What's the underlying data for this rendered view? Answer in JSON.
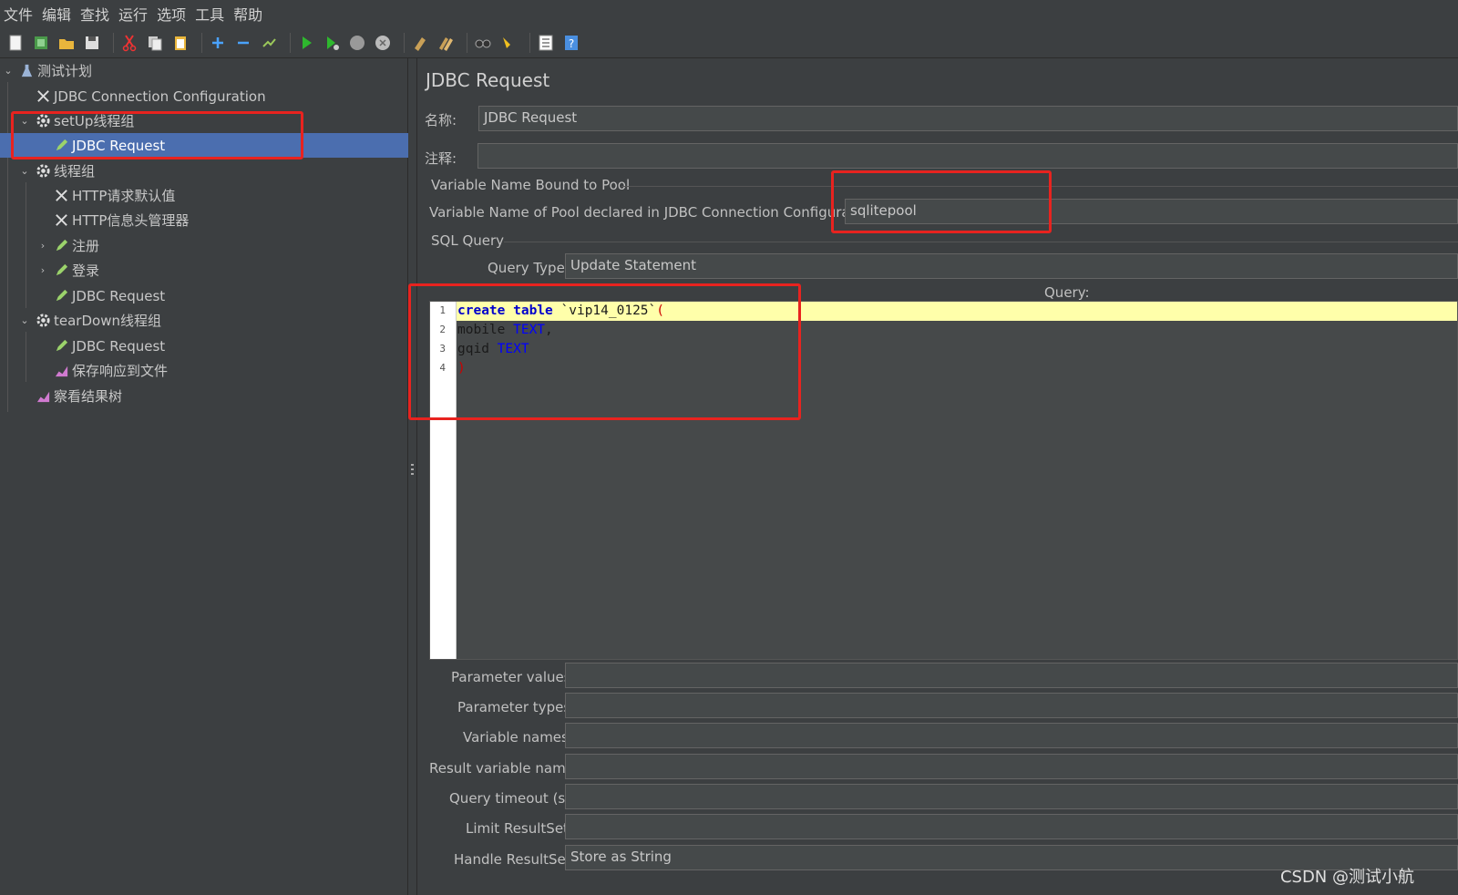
{
  "menu": [
    "文件",
    "编辑",
    "查找",
    "运行",
    "选项",
    "工具",
    "帮助"
  ],
  "toolbar_icons": [
    "new-icon",
    "templates-icon",
    "open-icon",
    "save-icon",
    "cut-icon",
    "copy-icon",
    "paste-icon",
    "expand-icon",
    "collapse-icon",
    "toggle-icon",
    "start-icon",
    "start-no-pause-icon",
    "stop-icon",
    "shutdown-icon",
    "clear-icon",
    "clear-all-icon",
    "search-icon",
    "reset-search-icon",
    "function-helper-icon",
    "help-icon"
  ],
  "tree": {
    "plan": "测试计划",
    "jdbc_config": "JDBC Connection Configuration",
    "setup_group": "setUp线程组",
    "setup_jdbc": "JDBC Request",
    "thread_group": "线程组",
    "http_defaults": "HTTP请求默认值",
    "http_headers": "HTTP信息头管理器",
    "register": "注册",
    "login": "登录",
    "tg_jdbc": "JDBC Request",
    "teardown_group": "tearDown线程组",
    "teardown_jdbc": "JDBC Request",
    "save_response": "保存响应到文件",
    "view_results": "察看结果树"
  },
  "main": {
    "title": "JDBC Request",
    "name_label": "名称:",
    "name_value": "JDBC Request",
    "comment_label": "注释:",
    "comment_value": "",
    "pool_section": "Variable Name Bound to Pool",
    "pool_label": "Variable Name of Pool declared in JDBC Connection Configuration:",
    "pool_value": "sqlitepool",
    "sql_section": "SQL Query",
    "query_type_label": "Query Type:",
    "query_type_value": "Update Statement",
    "query_label": "Query:",
    "line_numbers": [
      "1",
      "2",
      "3",
      "4"
    ],
    "code": {
      "l1_kw1": "create",
      "l1_kw2": "table",
      "l1_name": " `vip14_0125`",
      "l1_paren": "(",
      "l2_name": "mobile ",
      "l2_type": "TEXT",
      "l2_comma": ",",
      "l3_name": "gqid ",
      "l3_type": "TEXT",
      "l4_paren": ")"
    },
    "param_values_label": "Parameter values:",
    "param_values": "",
    "param_types_label": "Parameter types:",
    "param_types": "",
    "var_names_label": "Variable names:",
    "var_names": "",
    "result_var_label": "Result variable name:",
    "result_var": "",
    "timeout_label": "Query timeout (s):",
    "timeout": "",
    "limit_label": "Limit ResultSet:",
    "limit": "",
    "handle_label": "Handle ResultSet:",
    "handle_value": "Store as String"
  },
  "watermark": "CSDN @测试小航",
  "colors": {
    "background": "#3c3f41",
    "selection": "#4b6eaf",
    "highlight": "#e8231f",
    "current_line": "#ffffaa"
  }
}
